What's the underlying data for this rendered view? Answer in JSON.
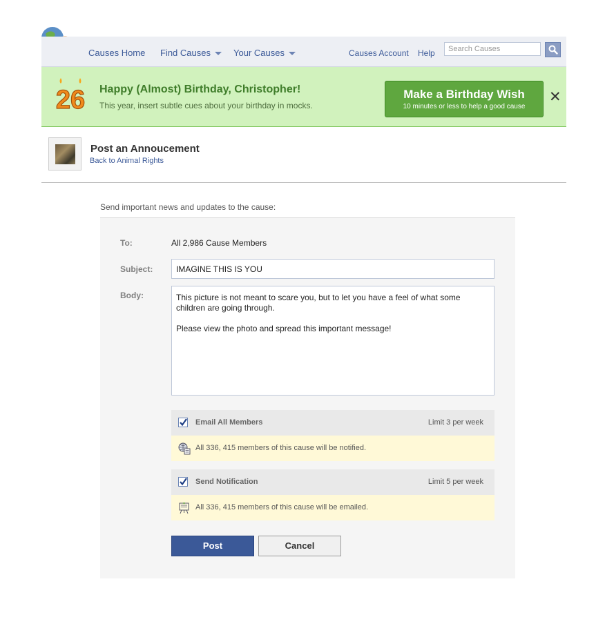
{
  "header": {
    "logo_icon": "causes-globe-people-icon",
    "nav": [
      {
        "label": "Causes Home",
        "has_dropdown": false
      },
      {
        "label": "Find Causes",
        "has_dropdown": true
      },
      {
        "label": "Your Causes",
        "has_dropdown": true
      }
    ],
    "account_label": "Causes Account",
    "help_label": "Help",
    "search_placeholder": "Search Causes",
    "search_icon": "magnifier-icon"
  },
  "banner": {
    "age_number": "26",
    "title": "Happy (Almost) Birthday, Christopher!",
    "subtitle": "This year, insert subtle cues about your birthday in mocks.",
    "wish_button_title": "Make a Birthday Wish",
    "wish_button_subtitle": "10 minutes or less to help a good cause",
    "close_glyph": "✕"
  },
  "page": {
    "title": "Post an Annoucement",
    "back_link": "Back to Animal Rights",
    "intro": "Send important news and updates to the cause:"
  },
  "form": {
    "to_label": "To:",
    "to_value": "All 2,986 Cause Members",
    "subject_label": "Subject:",
    "subject_value": "IMAGINE THIS IS YOU",
    "body_label": "Body:",
    "body_value": "This picture is not meant to scare you, but to let you have a feel of what some children are going through.\n\nPlease view the photo and spread this important message!",
    "options": [
      {
        "title": "Email All Members",
        "limit": "Limit 3 per week",
        "checked": true,
        "note": "All 336, 415 members of this cause will be notified.",
        "note_icon": "globe-notification-icon"
      },
      {
        "title": "Send Notification",
        "limit": "Limit 5 per week",
        "checked": true,
        "note": "All 336, 415 members of this cause will be emailed.",
        "note_icon": "envelope-easel-icon"
      }
    ],
    "post_label": "Post",
    "cancel_label": "Cancel"
  },
  "colors": {
    "brand_blue": "#3b5998",
    "banner_green": "#d1f2bd",
    "wish_button_green": "#5fa73f",
    "note_yellow": "#fff9d7"
  }
}
